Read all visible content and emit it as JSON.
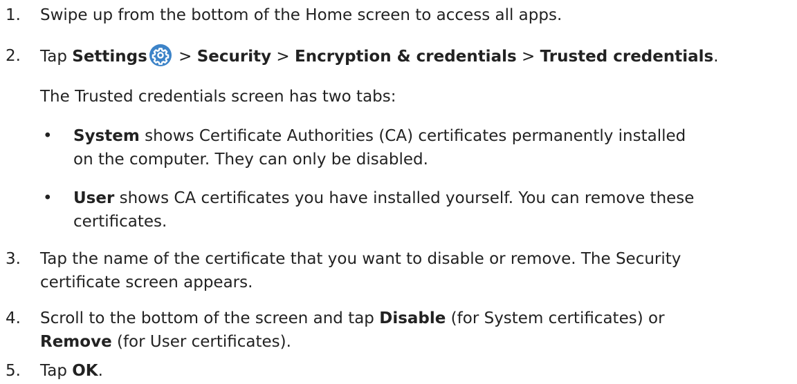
{
  "steps": [
    {
      "num": "1.",
      "text": "Swipe up from the bottom of the Home screen to access all apps."
    },
    {
      "num": "2.",
      "pre": "Tap ",
      "settings": "Settings",
      "sep1": " > ",
      "security": "Security",
      "sep2": " > ",
      "encryption": "Encryption & credentials",
      "sep3": " > ",
      "trusted": "Trusted credentials",
      "end": "."
    },
    {
      "num": "3.",
      "text_line1": "Tap the name of the certificate that you want to disable or remove. The Security",
      "text_line2": "certificate screen appears."
    },
    {
      "num": "4.",
      "line1_pre": "Scroll to the bottom of the screen and tap ",
      "disable": "Disable",
      "line1_post": " (for System certificates) or",
      "remove": "Remove",
      "line2_post": " (for User certificates)."
    },
    {
      "num": "5.",
      "pre": "Tap ",
      "ok": "OK",
      "end": "."
    }
  ],
  "tabs_intro": "The Trusted credentials screen has two tabs:",
  "bullets": [
    {
      "mark": "•",
      "bold": "System",
      "line1": " shows Certificate Authorities (CA) certificates permanently installed",
      "line2": "on the computer. They can only be disabled."
    },
    {
      "mark": "•",
      "bold": "User",
      "line1": " shows CA certificates you have installed yourself. You can remove these",
      "line2": "certificates."
    }
  ],
  "icons": {
    "settings": "gear-icon",
    "settings_color": "#3c83c8"
  }
}
